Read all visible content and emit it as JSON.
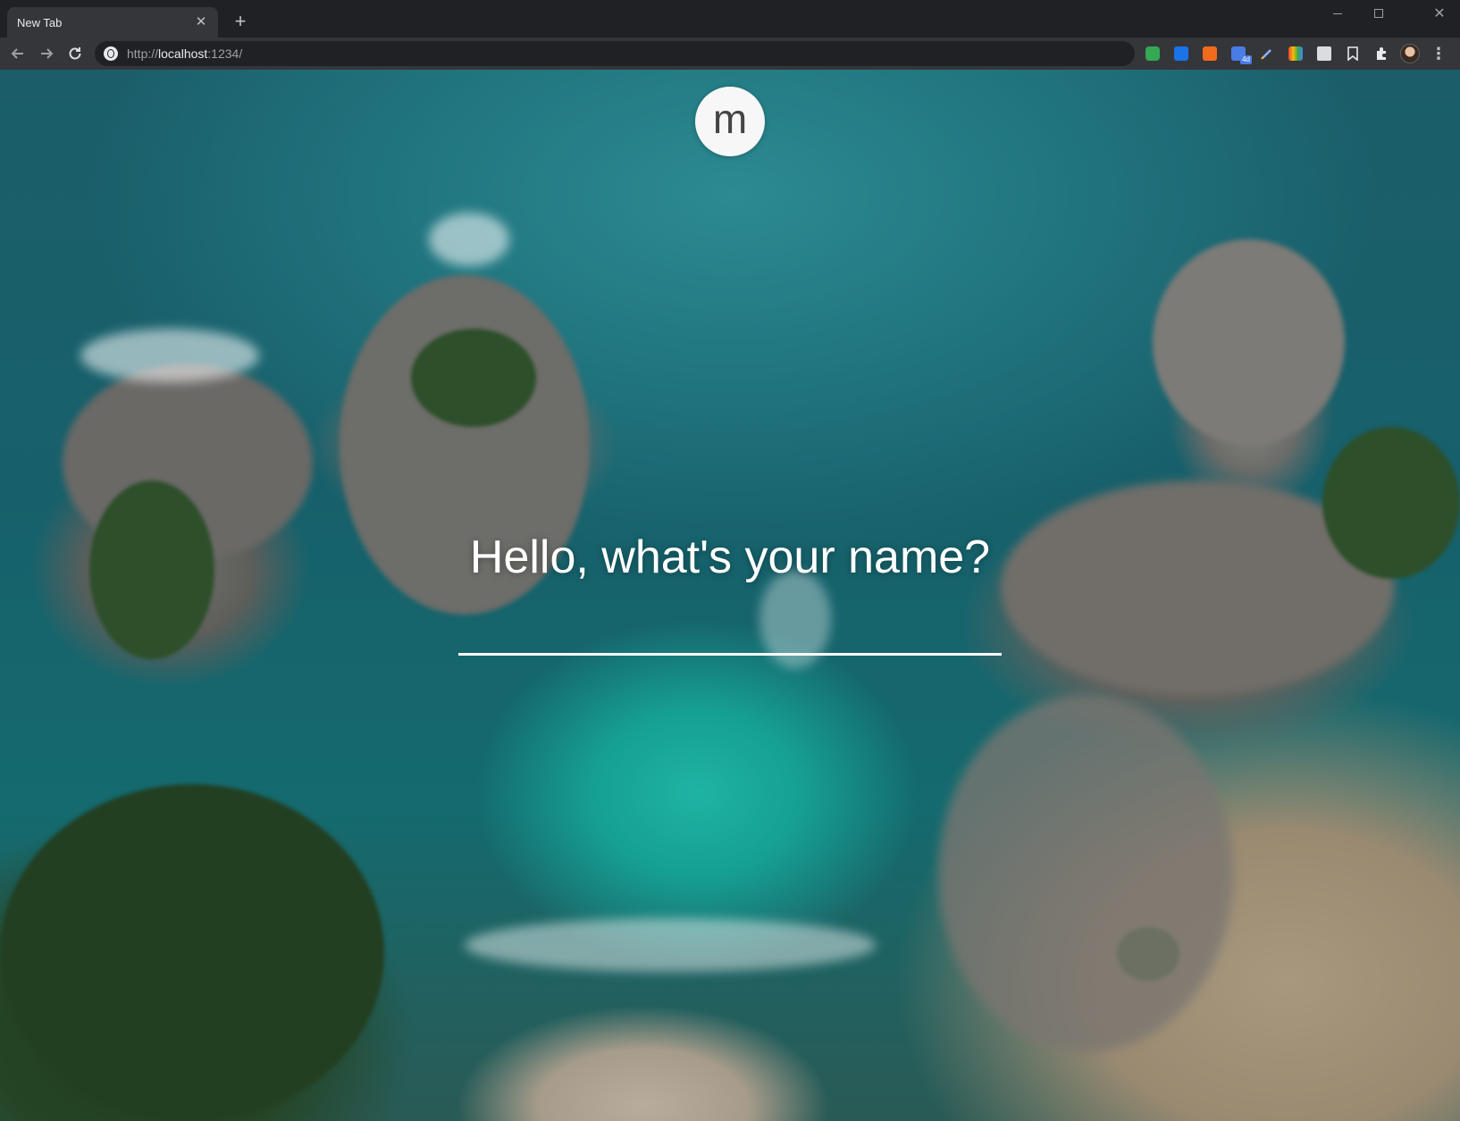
{
  "browser": {
    "tab_title": "New Tab",
    "tab_close": "✕",
    "new_tab": "+",
    "url_scheme": "http://",
    "url_host": "localhost",
    "url_rest": ":1234/",
    "window_close": "✕",
    "menu": "⋮",
    "extensions": [
      {
        "name": "green-extension-icon",
        "color": "#34a853"
      },
      {
        "name": "blue-window-extension-icon",
        "color": "#1a73e8"
      },
      {
        "name": "orange-grid-extension-icon",
        "color": "#f26b1d"
      },
      {
        "name": "calendar-extension-icon",
        "color": "#4a7ce8",
        "badge": "4d"
      },
      {
        "name": "pen-extension-icon",
        "color": "#8ab4f8"
      },
      {
        "name": "colorful-extension-icon",
        "color": "#ea4335"
      },
      {
        "name": "mail-extension-icon",
        "color": "#dadce0"
      }
    ]
  },
  "page": {
    "logo_letter": "m",
    "prompt": "Hello, what's your name?",
    "name_value": ""
  }
}
